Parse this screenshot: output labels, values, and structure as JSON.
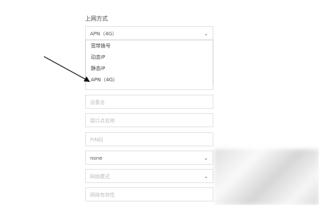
{
  "form": {
    "connection_label": "上网方式",
    "connection_value": "APN（4G）",
    "dropdown_options": [
      "宽带拨号",
      "动态IP",
      "静态IP",
      "APN（4G）"
    ],
    "device_name_placeholder": "设备名",
    "apn_name_placeholder": "接口点名称",
    "pin_placeholder": "PIN码",
    "auth_value": "none",
    "network_mode_placeholder": "网络模式",
    "network_validity_placeholder": "网络有效性"
  },
  "icons": {
    "chevron": "chevron-down-icon",
    "pointer": "arrow-annotation"
  }
}
